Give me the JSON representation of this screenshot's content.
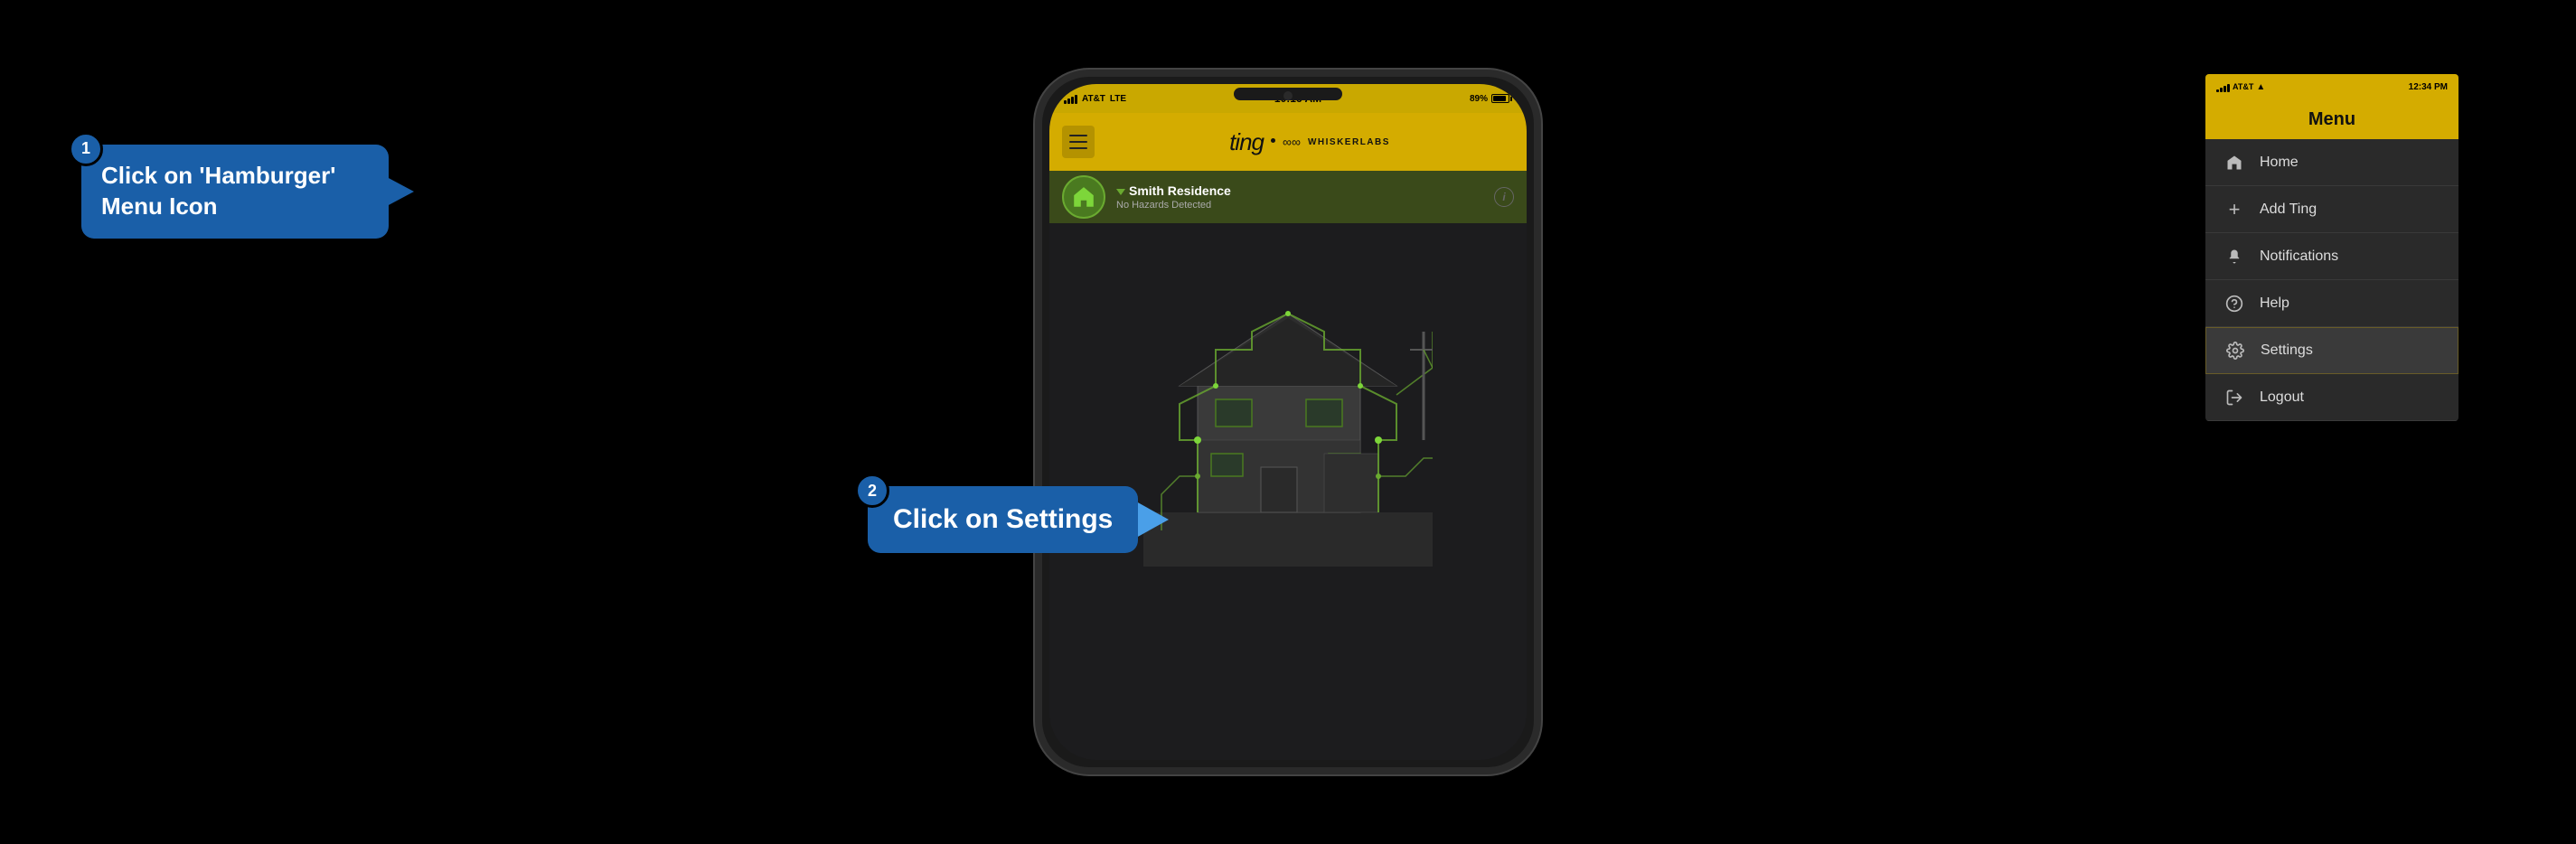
{
  "page": {
    "background": "#000000"
  },
  "phone": {
    "status_bar": {
      "carrier": "AT&T",
      "network": "LTE",
      "time": "10:16 AM",
      "battery": "89%",
      "battery_icon": "🔋"
    },
    "header": {
      "logo_ting": "ting",
      "logo_separator": "∞",
      "logo_brand": "WHISKERLABS"
    },
    "location": {
      "name": "Smith Residence",
      "status": "No Hazards Detected"
    }
  },
  "callout_1": {
    "step_number": "1",
    "text": "Click on 'Hamburger' Menu Icon"
  },
  "callout_2": {
    "step_number": "2",
    "text": "Click on Settings"
  },
  "side_menu": {
    "status_bar": {
      "carrier": "AT&T",
      "wifi": "▲",
      "time": "12:34 PM"
    },
    "title": "Menu",
    "items": [
      {
        "id": "home",
        "icon": "🏠",
        "label": "Home"
      },
      {
        "id": "add-ting",
        "icon": "+",
        "label": "Add Ting"
      },
      {
        "id": "notifications",
        "icon": "🔔",
        "label": "Notifications"
      },
      {
        "id": "help",
        "icon": "?",
        "label": "Help"
      },
      {
        "id": "settings",
        "icon": "⚙",
        "label": "Settings"
      },
      {
        "id": "logout",
        "icon": "→",
        "label": "Logout"
      }
    ]
  }
}
